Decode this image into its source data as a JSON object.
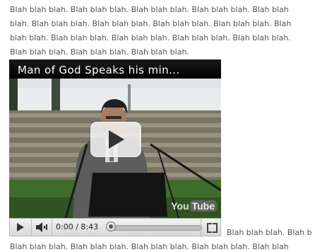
{
  "paragraph": {
    "lines_above": [
      "Blah blah blah.  Blah blah blah.  Blah blah blah.  Blah blah blah.  Blah blah",
      "blah.  Blah blah blah.  Blah blah blah.  Blah blah blah.  Blah blah blah.  Blah",
      "blah blah.  Blah blah blah.  Blah blah blah.  Blah blah blah.  Blah blah blah.",
      "Blah blah blah.  Blah blah blah.  Blah blah blah."
    ],
    "line_beside_player": "Blah blah blah.  Blah b",
    "line_below": "Blah blah blah.  Blah blah blah.  Blah blah blah.  Blah blah blah.  Blah blah"
  },
  "video": {
    "title": "Man of God Speaks his min...",
    "logo_you": "You",
    "logo_tube": "Tube",
    "play_overlay_icon": "play-icon"
  },
  "controls": {
    "time": "0:00 / 8:43",
    "play_icon": "play-icon",
    "volume_icon": "speaker-icon",
    "fullscreen_icon": "fullscreen-icon",
    "progress": 0
  },
  "colors": {
    "text": "#555555",
    "title_bar": "#000000",
    "controls_bg": "#e4e4e4"
  }
}
